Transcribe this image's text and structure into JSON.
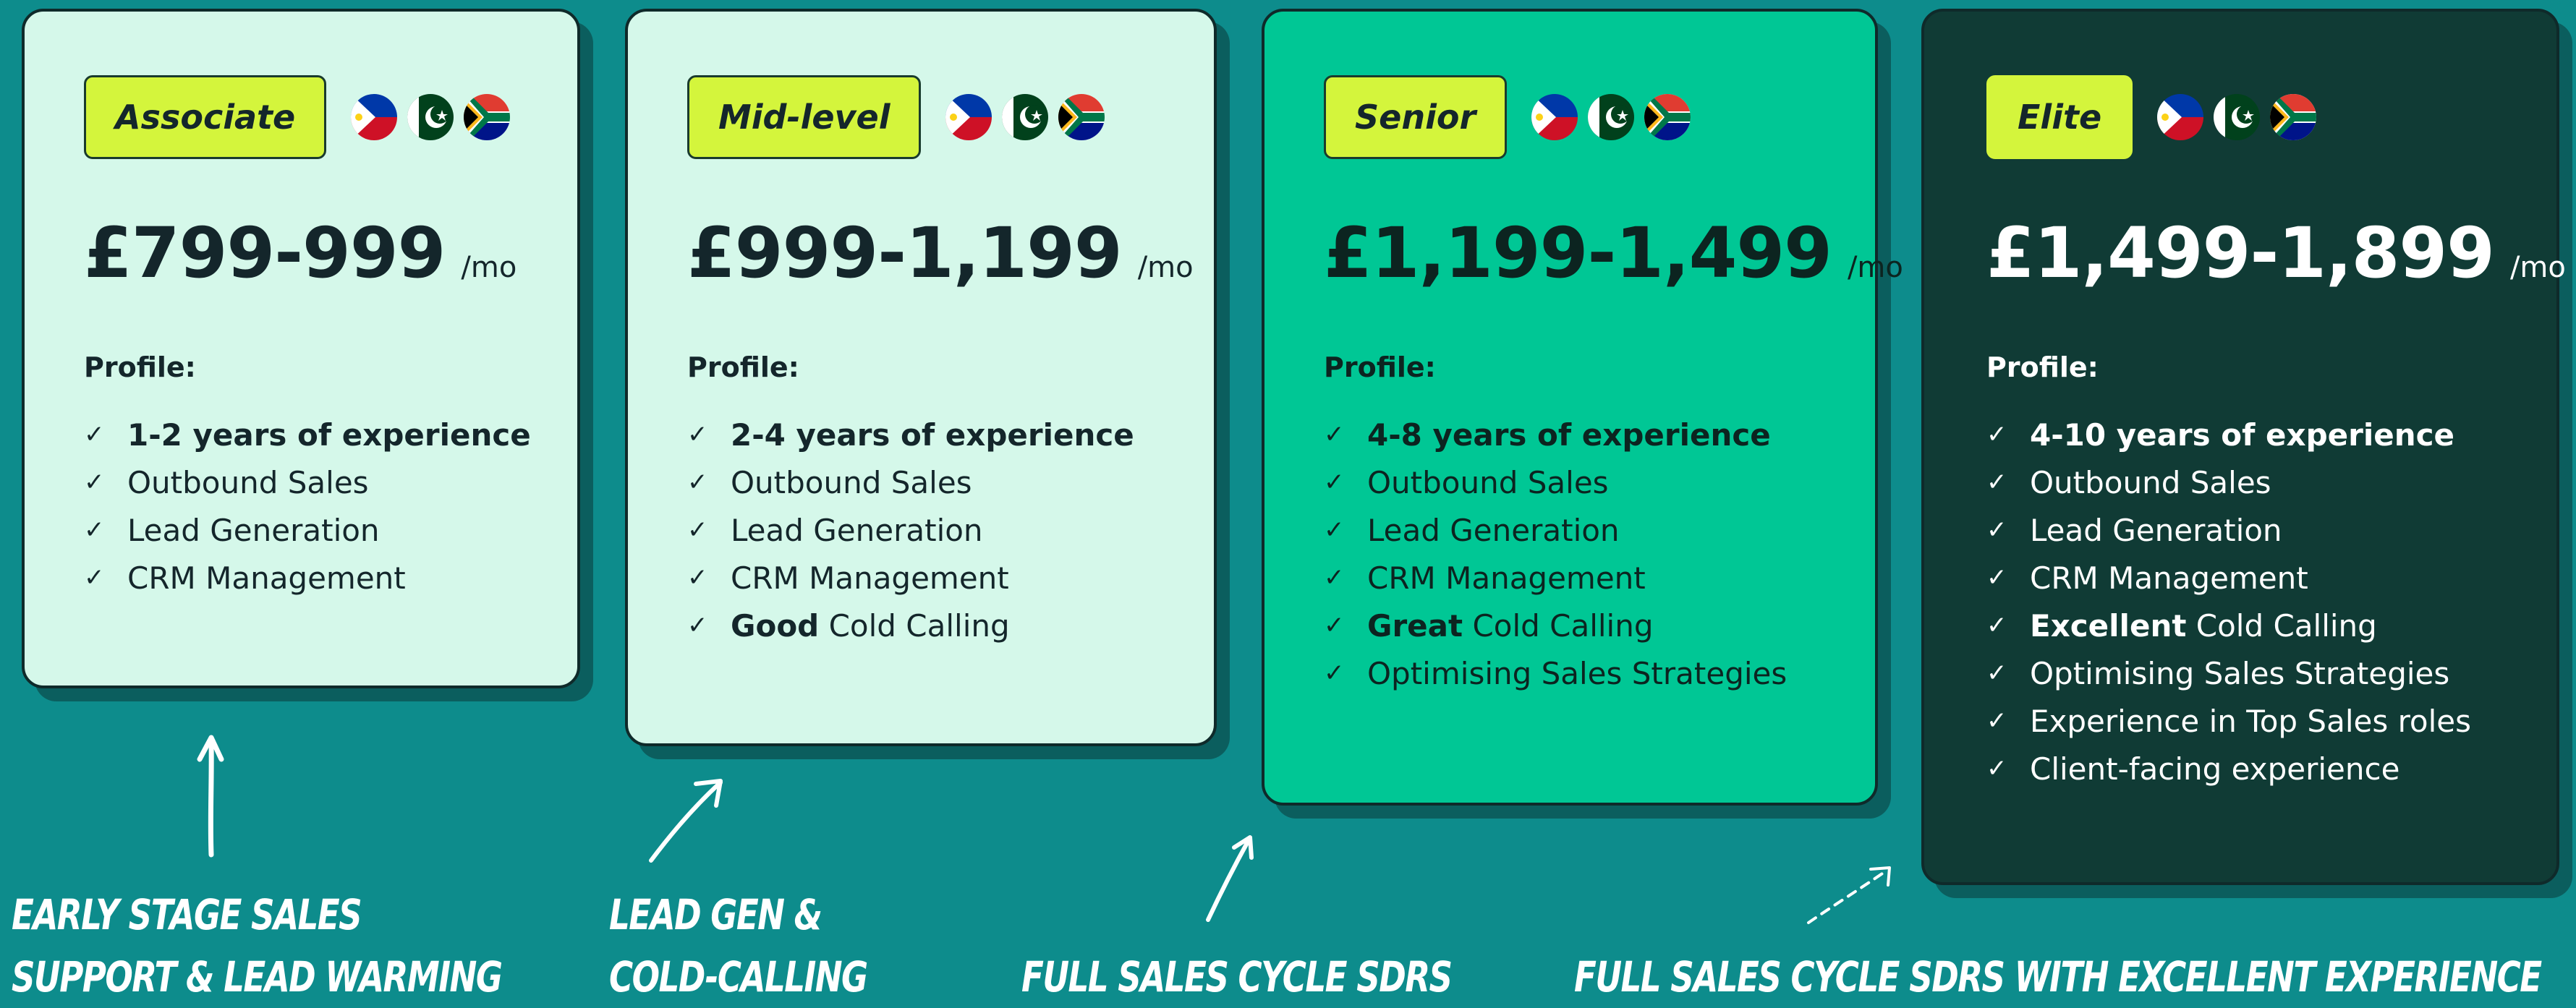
{
  "tiers": [
    {
      "badge": "Associate",
      "price": "£799-999",
      "unit": "/mo",
      "profile_label": "Profile:",
      "items": [
        {
          "bold": "1-2 years of experience",
          "rest": ""
        },
        {
          "bold": "",
          "rest": "Outbound Sales"
        },
        {
          "bold": "",
          "rest": "Lead Generation"
        },
        {
          "bold": "",
          "rest": "CRM Management"
        }
      ],
      "flags": [
        "philippines-flag-icon",
        "pakistan-flag-icon",
        "south-africa-flag-icon"
      ]
    },
    {
      "badge": "Mid-level",
      "price": "£999-1,199",
      "unit": "/mo",
      "profile_label": "Profile:",
      "items": [
        {
          "bold": "2-4 years of experience",
          "rest": ""
        },
        {
          "bold": "",
          "rest": "Outbound Sales"
        },
        {
          "bold": "",
          "rest": "Lead Generation"
        },
        {
          "bold": "",
          "rest": "CRM Management"
        },
        {
          "bold": "Good",
          "rest": " Cold Calling"
        }
      ],
      "flags": [
        "philippines-flag-icon",
        "pakistan-flag-icon",
        "south-africa-flag-icon"
      ]
    },
    {
      "badge": "Senior",
      "price": "£1,199-1,499",
      "unit": "/mo",
      "profile_label": "Profile:",
      "items": [
        {
          "bold": "4-8 years of experience",
          "rest": ""
        },
        {
          "bold": "",
          "rest": "Outbound Sales"
        },
        {
          "bold": "",
          "rest": "Lead Generation"
        },
        {
          "bold": "",
          "rest": "CRM Management"
        },
        {
          "bold": "Great",
          "rest": " Cold Calling"
        },
        {
          "bold": "",
          "rest": "Optimising Sales Strategies"
        }
      ],
      "flags": [
        "philippines-flag-icon",
        "pakistan-flag-icon",
        "south-africa-flag-icon"
      ]
    },
    {
      "badge": "Elite",
      "price": "£1,499-1,899",
      "unit": "/mo",
      "profile_label": "Profile:",
      "items": [
        {
          "bold": "4-10 years of experience",
          "rest": ""
        },
        {
          "bold": "",
          "rest": "Outbound Sales"
        },
        {
          "bold": "",
          "rest": "Lead Generation"
        },
        {
          "bold": "",
          "rest": "CRM Management"
        },
        {
          "bold": "Excellent",
          "rest": " Cold Calling"
        },
        {
          "bold": "",
          "rest": "Optimising Sales Strategies"
        },
        {
          "bold": "",
          "rest": "Experience in Top Sales roles"
        },
        {
          "bold": "",
          "rest": "Client-facing experience"
        }
      ],
      "flags": [
        "philippines-flag-icon",
        "pakistan-flag-icon",
        "south-africa-flag-icon"
      ]
    }
  ],
  "captions": {
    "associate": [
      "Early stage sales",
      "support & lead warming"
    ],
    "mid": [
      "Lead gen &",
      "cold-calling"
    ],
    "senior": [
      "Full sales cycle SDRs"
    ],
    "elite": [
      "Full sales cycle SDRs with excellent experience"
    ]
  },
  "colors": {
    "background": "#0d8c8c",
    "light_card": "#d5f8ea",
    "senior_card": "#00c795",
    "elite_card": "#103b35",
    "badge": "#d4f53c"
  }
}
